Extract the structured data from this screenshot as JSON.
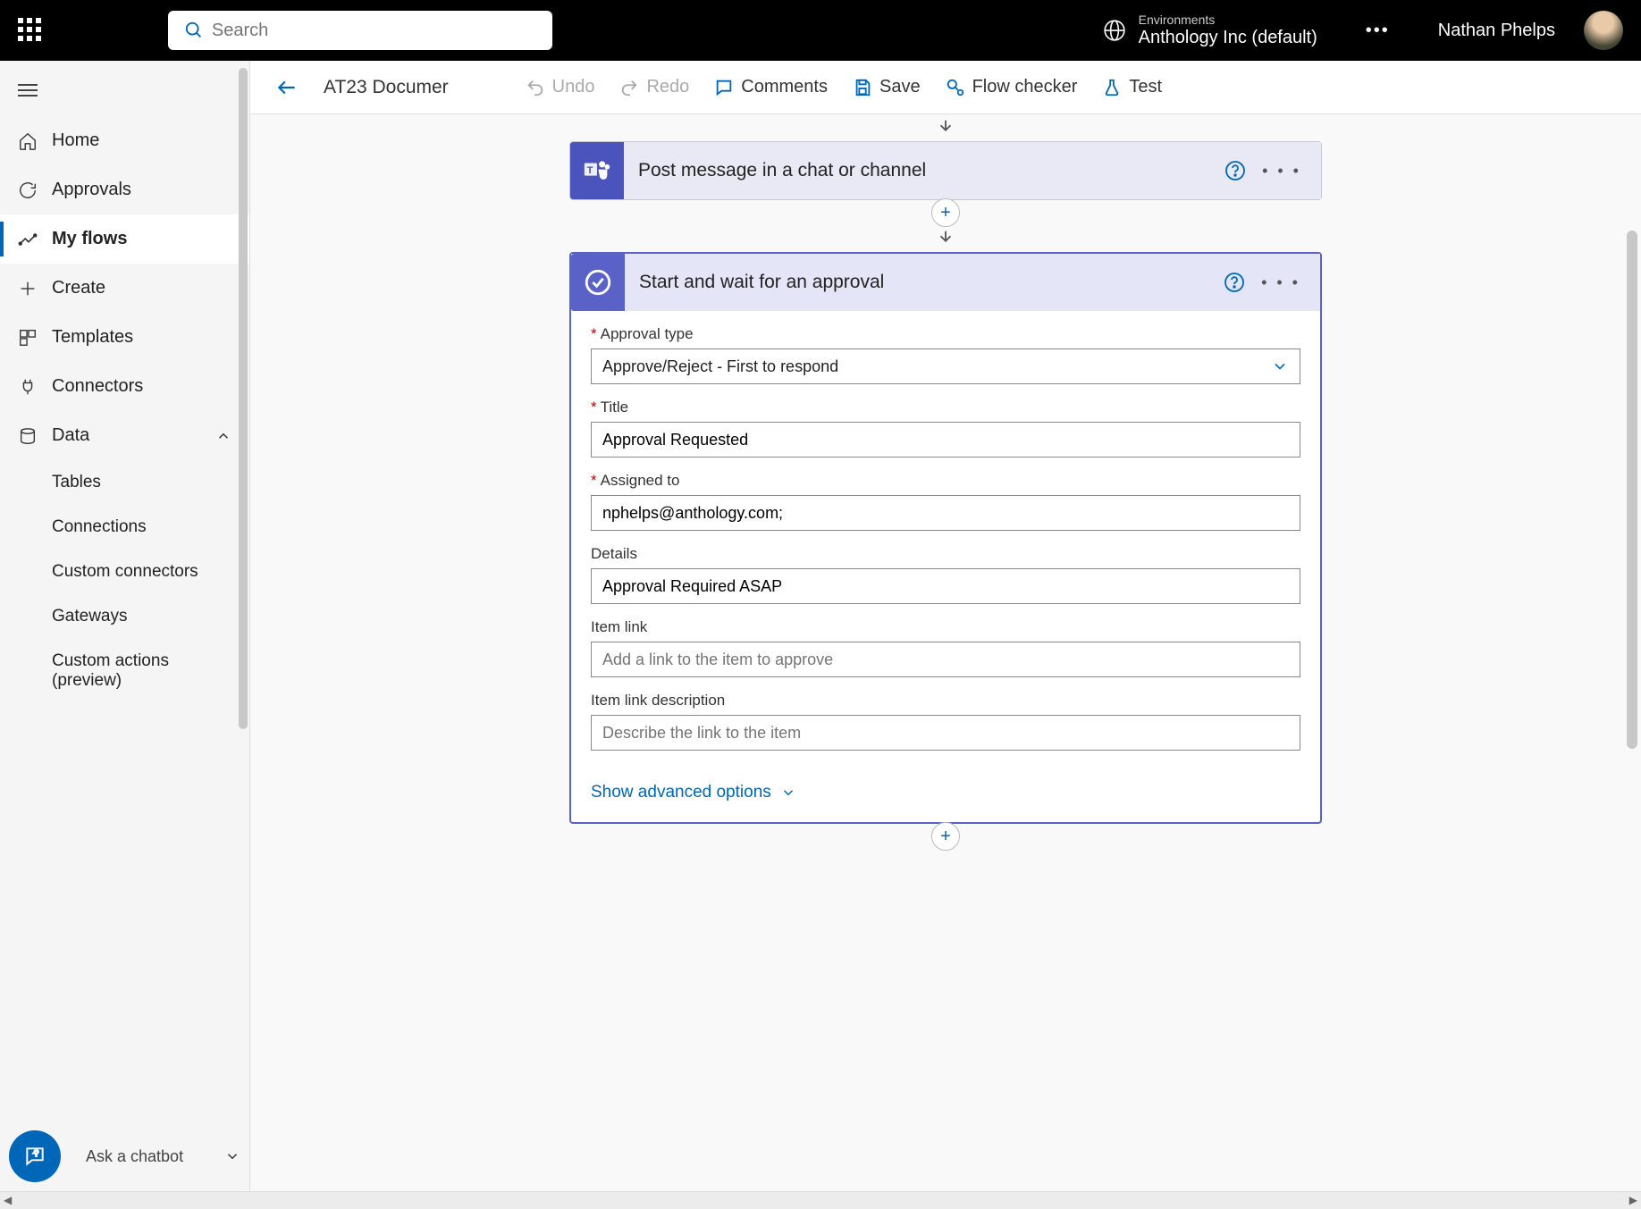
{
  "topbar": {
    "search_placeholder": "Search",
    "env_label": "Environments",
    "env_name": "Anthology Inc (default)",
    "user_name": "Nathan Phelps"
  },
  "sidebar": {
    "items": [
      {
        "label": "Home"
      },
      {
        "label": "Approvals"
      },
      {
        "label": "My flows"
      },
      {
        "label": "Create"
      },
      {
        "label": "Templates"
      },
      {
        "label": "Connectors"
      },
      {
        "label": "Data"
      }
    ],
    "data_sub": [
      {
        "label": "Tables"
      },
      {
        "label": "Connections"
      },
      {
        "label": "Custom connectors"
      },
      {
        "label": "Gateways"
      },
      {
        "label": "Custom actions (preview)"
      }
    ],
    "chatbot_label": "Ask a chatbot"
  },
  "toolbar": {
    "flow_name": "AT23 Documer",
    "undo": "Undo",
    "redo": "Redo",
    "comments": "Comments",
    "save": "Save",
    "checker": "Flow checker",
    "test": "Test"
  },
  "cards": {
    "teams_title": "Post message in a chat or channel",
    "approval_title": "Start and wait for an approval"
  },
  "form": {
    "approval_type_label": "Approval type",
    "approval_type_value": "Approve/Reject - First to respond",
    "title_label": "Title",
    "title_value": "Approval Requested",
    "assigned_label": "Assigned to",
    "assigned_value": "nphelps@anthology.com;",
    "details_label": "Details",
    "details_value": "Approval Required ASAP",
    "item_link_label": "Item link",
    "item_link_placeholder": "Add a link to the item to approve",
    "item_link_desc_label": "Item link description",
    "item_link_desc_placeholder": "Describe the link to the item",
    "advanced": "Show advanced options"
  }
}
